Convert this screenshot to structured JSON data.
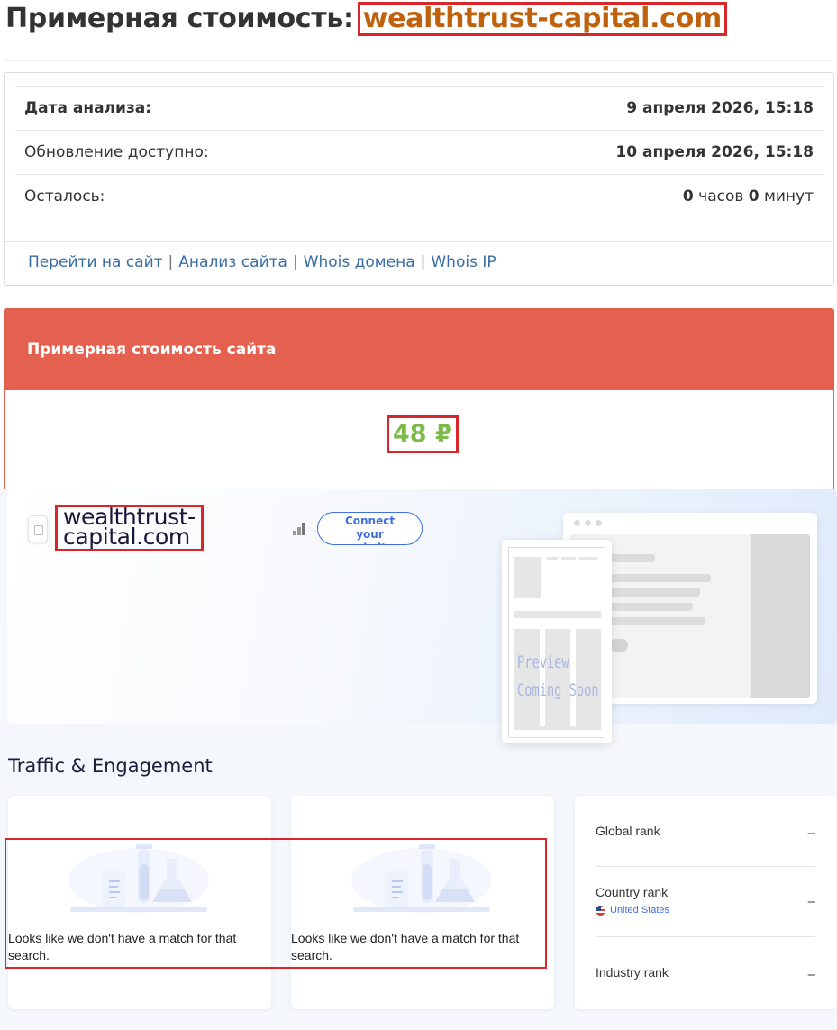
{
  "header": {
    "title_prefix": "Примерная стоимость:",
    "domain": "wealthtrust-capital.com"
  },
  "analysis": {
    "rows": [
      {
        "label": "Дата анализа:",
        "value": "9 апреля 2026, 15:18"
      },
      {
        "label": "Обновление доступно:",
        "value": "10 апреля 2026, 15:18"
      }
    ],
    "remaining": {
      "label": "Осталось:",
      "hours": "0",
      "hours_unit": "часов",
      "minutes": "0",
      "minutes_unit": "минут"
    },
    "links": [
      "Перейти на сайт",
      "Анализ сайта",
      "Whois домена",
      "Whois IP"
    ]
  },
  "valuation": {
    "title": "Примерная стоимость сайта",
    "price": "48 ₽"
  },
  "similarweb": {
    "domain_line1": "wealthtrust-",
    "domain_line2": "capital.com",
    "connect_button": [
      "Connect",
      "your",
      "website"
    ],
    "preview_text": [
      "Preview",
      "Coming Soon"
    ],
    "section_title": "Traffic & Engagement",
    "empty_message": "Looks like we don't have a match for that search.",
    "ranks": [
      {
        "label": "Global rank",
        "value": "–"
      },
      {
        "label": "Country rank",
        "value": "–",
        "country": "United States"
      },
      {
        "label": "Industry rank",
        "value": "–"
      }
    ]
  },
  "colors": {
    "domain_highlight": "#c0620d",
    "valuation_header": "#e46150",
    "price": "#7cbb4a",
    "annotation_box": "#d9262b",
    "link": "#3a6ea5",
    "accent_blue": "#3f6fe0"
  }
}
